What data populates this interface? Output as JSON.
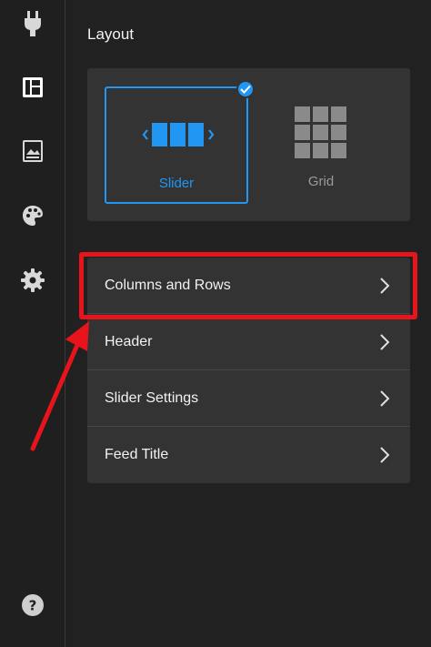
{
  "sidebar": {
    "items": [
      {
        "icon": "plug-icon"
      },
      {
        "icon": "layout-icon"
      },
      {
        "icon": "image-icon"
      },
      {
        "icon": "palette-icon"
      },
      {
        "icon": "gear-icon"
      }
    ],
    "help_icon": "help-icon"
  },
  "layout": {
    "title": "Layout",
    "options": [
      {
        "label": "Slider",
        "selected": true
      },
      {
        "label": "Grid",
        "selected": false
      }
    ]
  },
  "menu": {
    "items": [
      {
        "label": "Columns and Rows"
      },
      {
        "label": "Header"
      },
      {
        "label": "Slider Settings"
      },
      {
        "label": "Feed Title"
      }
    ]
  },
  "colors": {
    "accent": "#2196f3",
    "annotation": "#e8141c",
    "panel": "#333333",
    "background": "#212121"
  }
}
